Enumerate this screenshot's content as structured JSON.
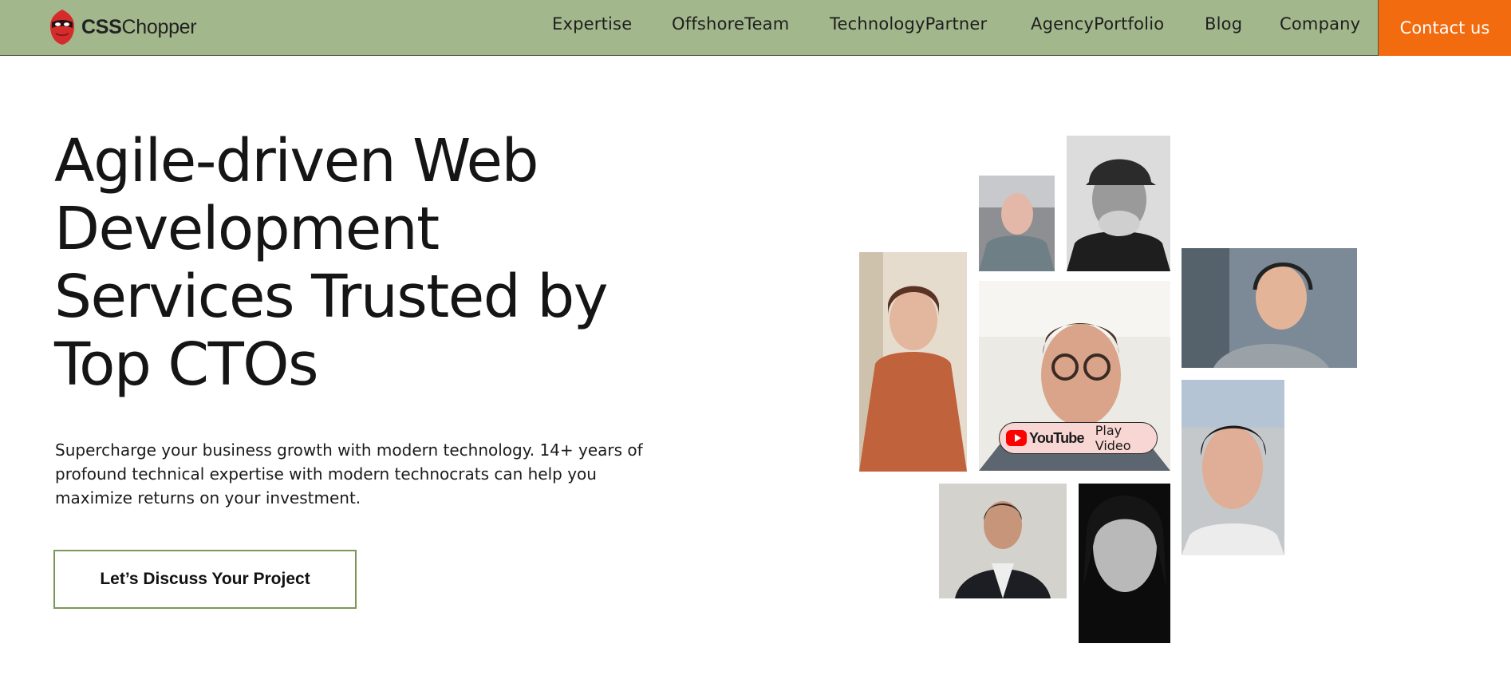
{
  "brand": {
    "name_bold": "CSS",
    "name_regular": "Chopper",
    "logo_icon": "ninja-mask-icon"
  },
  "nav": {
    "items": [
      {
        "label": "Expertise"
      },
      {
        "label": "OffshoreTeam"
      },
      {
        "label": "TechnologyPartner"
      },
      {
        "label": "AgencyPortfolio"
      },
      {
        "label": "Blog"
      },
      {
        "label": "Company"
      }
    ],
    "contact_label": "Contact us"
  },
  "hero": {
    "headline_lines": [
      "Agile-driven Web",
      "Development",
      "Services Trusted by",
      "Top CTOs"
    ],
    "subtext_lines": [
      "Supercharge your business growth with modern technology. 14+ years of",
      "profound technical expertise with modern technocrats can help you",
      "maximize returns on your investment."
    ],
    "cta_label": "Let’s Discuss Your Project"
  },
  "video": {
    "youtube_wordmark": "YouTube",
    "play_label": "Play Video",
    "play_icon": "youtube-play-icon"
  },
  "colors": {
    "header_bg": "#a3b78c",
    "contact_bg": "#f26b0f",
    "cta_border": "#7a9758",
    "youtube_red": "#ff0000"
  }
}
